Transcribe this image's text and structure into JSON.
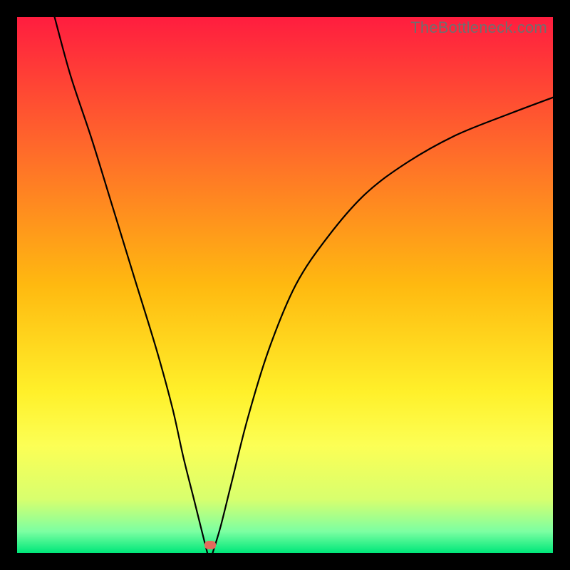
{
  "watermark": "TheBottleneck.com",
  "chart_data": {
    "type": "line",
    "title": "",
    "xlabel": "",
    "ylabel": "",
    "xlim": [
      0,
      100
    ],
    "ylim": [
      0,
      100
    ],
    "grid": false,
    "legend": false,
    "gradient_bands": [
      {
        "stop": 0.0,
        "color": "#ff1d3f"
      },
      {
        "stop": 0.25,
        "color": "#ff6b2a"
      },
      {
        "stop": 0.5,
        "color": "#ffb910"
      },
      {
        "stop": 0.7,
        "color": "#fff02a"
      },
      {
        "stop": 0.8,
        "color": "#fcff55"
      },
      {
        "stop": 0.9,
        "color": "#d8ff6e"
      },
      {
        "stop": 0.96,
        "color": "#7cffa2"
      },
      {
        "stop": 1.0,
        "color": "#00e77a"
      }
    ],
    "series": [
      {
        "name": "curve-left",
        "x": [
          7,
          10,
          14,
          18,
          22,
          26,
          29,
          31,
          33,
          34.5,
          35.5
        ],
        "y": [
          100,
          89,
          77,
          64,
          51,
          38,
          27,
          18,
          10,
          4,
          0
        ]
      },
      {
        "name": "curve-right",
        "x": [
          36.5,
          38,
          40,
          43,
          47,
          52,
          58,
          65,
          73,
          82,
          92,
          100
        ],
        "y": [
          0,
          5,
          13,
          25,
          38,
          50,
          59,
          67,
          73,
          78,
          82,
          85
        ]
      }
    ],
    "marker": {
      "name": "bottleneck-point",
      "x": 36,
      "y": 1.5,
      "color": "#e36a5c"
    }
  }
}
